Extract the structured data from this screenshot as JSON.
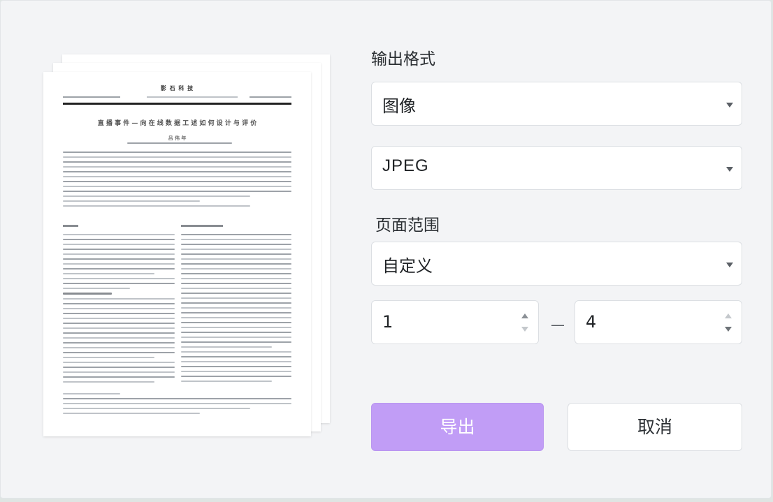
{
  "preview": {
    "header": "影 石 科 技",
    "title": "直 播 事 件 — 向 在 线 数 据 ⼯ 述 如 何 设 计 与 评 价",
    "author": "吕 伟 年"
  },
  "form": {
    "output_format_label": "输出格式",
    "output_type": {
      "value": "图像"
    },
    "image_format": {
      "value": "JPEG"
    },
    "page_range_label": "页面范围",
    "page_range_mode": {
      "value": "自定义"
    },
    "range_from": "1",
    "range_separator": "—",
    "range_to": "4"
  },
  "buttons": {
    "export_label": "导出",
    "cancel_label": "取消"
  },
  "colors": {
    "primary_button": "#c19df6",
    "background": "#f3f4f6"
  }
}
